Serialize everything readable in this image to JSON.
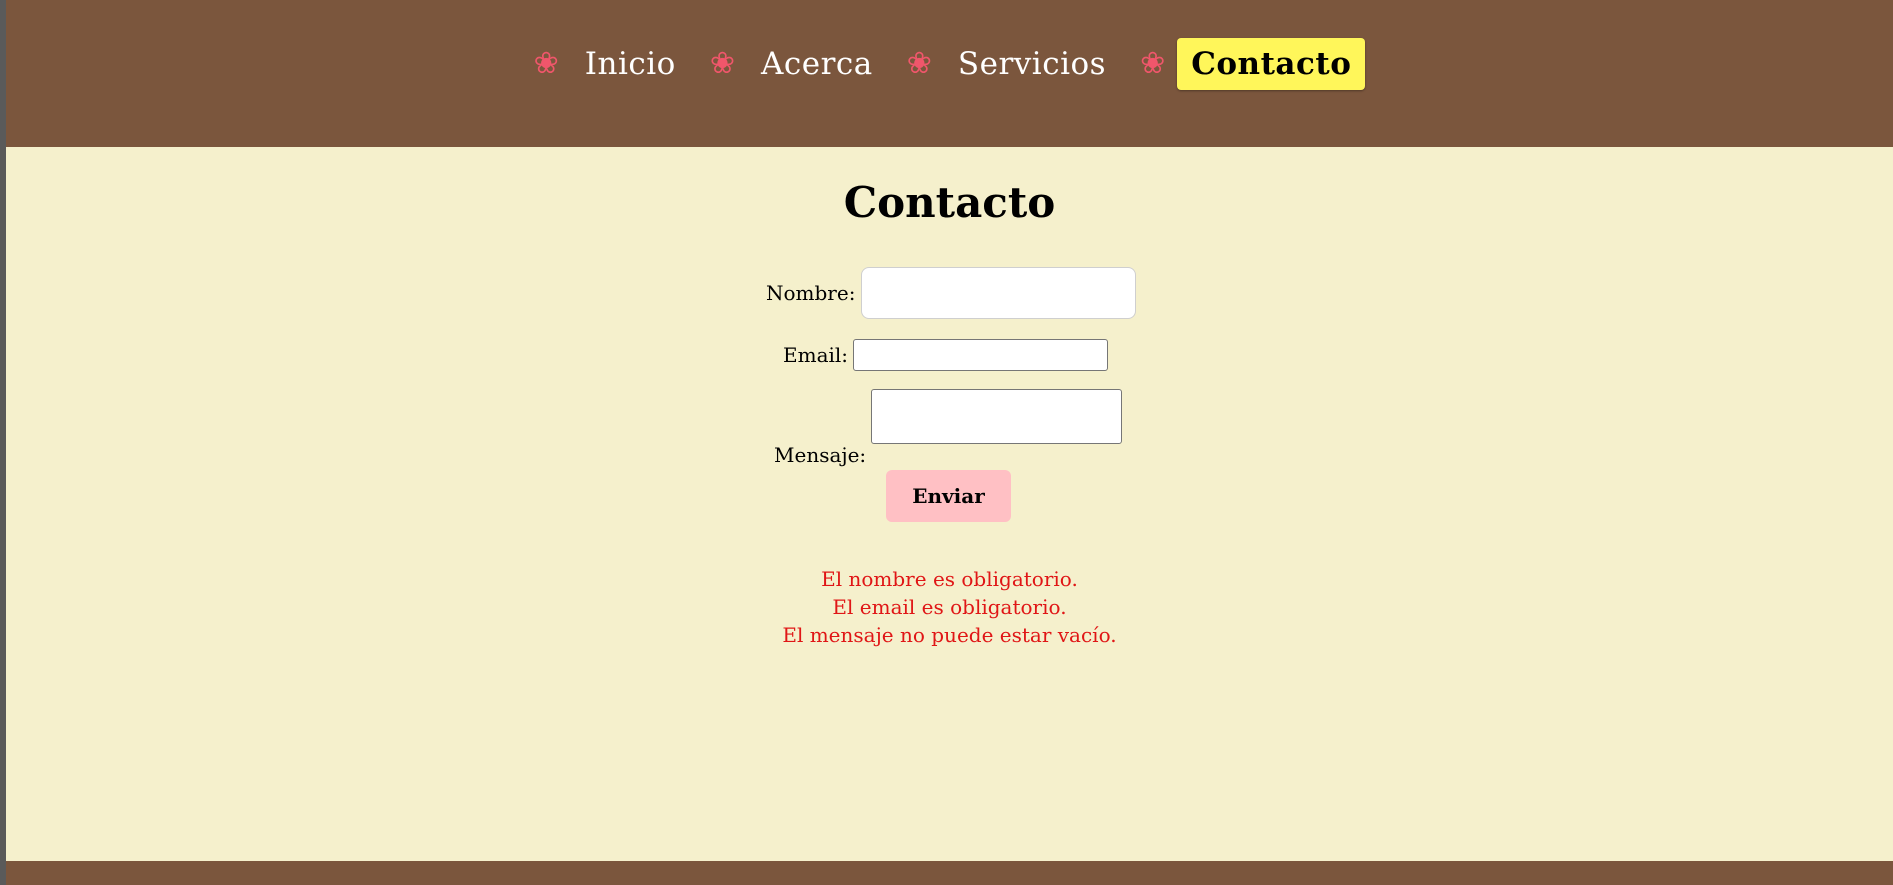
{
  "nav": {
    "items": [
      {
        "icon": "flower-icon",
        "glyph": "❀",
        "label": "Inicio",
        "active": false
      },
      {
        "icon": "flower-icon",
        "glyph": "❀",
        "label": "Acerca",
        "active": false
      },
      {
        "icon": "flower-icon",
        "glyph": "❀",
        "label": "Servicios",
        "active": false
      },
      {
        "icon": "flower-icon",
        "glyph": "❀",
        "label": "Contacto",
        "active": true
      }
    ]
  },
  "page": {
    "title": "Contacto"
  },
  "form": {
    "name_label": "Nombre:",
    "name_value": "",
    "email_label": "Email:",
    "email_value": "",
    "message_label": "Mensaje:",
    "message_value": "",
    "submit_label": "Enviar"
  },
  "errors": [
    "El nombre es obligatorio.",
    "El email es obligatorio.",
    "El mensaje no puede estar vacío."
  ],
  "colors": {
    "header_bg": "#7b563d",
    "page_bg": "#f5f0cc",
    "active_nav_bg": "#fff65a",
    "flower": "#f0566b",
    "submit_bg": "#ffc0c4",
    "error_text": "#e01616"
  }
}
